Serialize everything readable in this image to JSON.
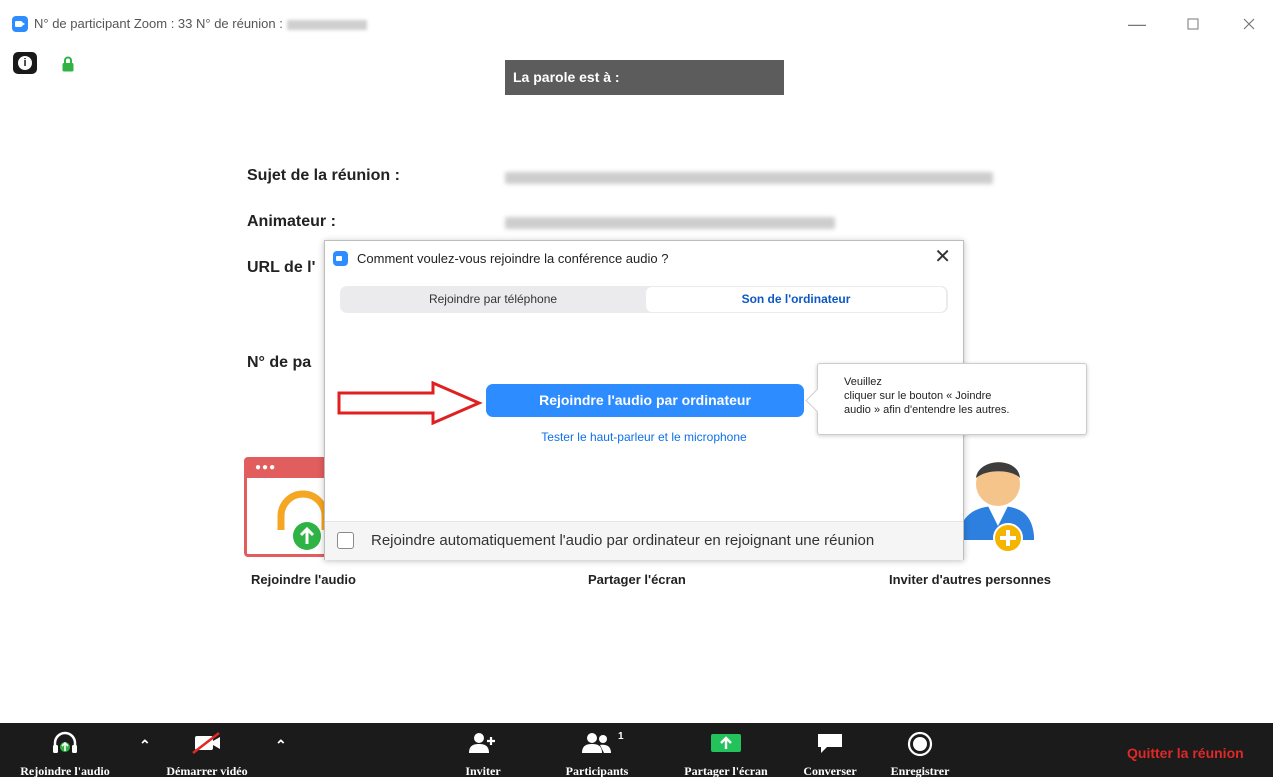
{
  "window": {
    "title": "N° de participant Zoom : 33   N° de réunion :",
    "controls": [
      "minimize",
      "maximize",
      "close"
    ]
  },
  "speaker_banner": "La parole est à :",
  "meeting_info": {
    "subject_label": "Sujet de la réunion :",
    "host_label": "Animateur :",
    "url_label": "URL de l'",
    "number_label": "N° de pa"
  },
  "features": {
    "audio_label": "Rejoindre l'audio",
    "share_label": "Partager l'écran",
    "invite_label": "Inviter d'autres personnes"
  },
  "dialog": {
    "title": "Comment voulez-vous rejoindre la conférence audio ?",
    "tabs": [
      {
        "label": "Rejoindre par téléphone",
        "active": false
      },
      {
        "label": "Son de l'ordinateur",
        "active": true
      }
    ],
    "join_button": "Rejoindre l'audio par ordinateur",
    "test_link": "Tester le haut-parleur et le microphone",
    "auto_join_label": "Rejoindre automatiquement l'audio par ordinateur en rejoignant une réunion",
    "auto_join_checked": false
  },
  "tooltip": {
    "line1": "Veuillez",
    "line2": "cliquer sur le bouton « Joindre",
    "line3": "audio » afin d'entendre les autres."
  },
  "toolbar": {
    "join_audio": "Rejoindre l'audio",
    "start_video": "Démarrer vidéo",
    "invite": "Inviter",
    "participants": "Participants",
    "participants_count": "1",
    "share_screen": "Partager l'écran",
    "chat": "Converser",
    "record": "Enregistrer",
    "leave": "Quitter la réunion"
  },
  "colors": {
    "accent": "#2d8cff",
    "toolbar_bg": "#1b1b1b",
    "leave": "#e02828",
    "share_green": "#23c25a",
    "arrow_red": "#e02020"
  }
}
